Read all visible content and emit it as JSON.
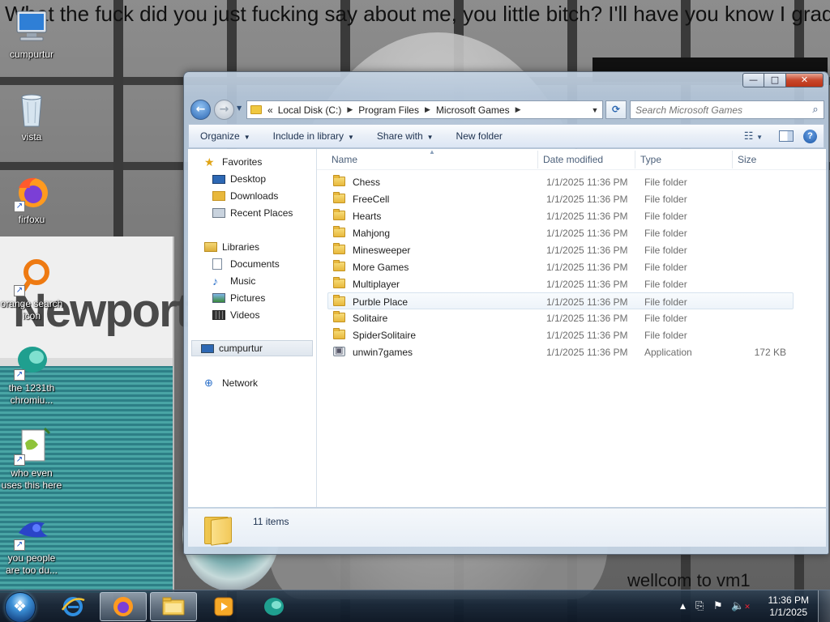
{
  "wallpaper": {
    "top_text": "What the fuck did you just fucking say about me, you little bitch? I'll have you know I graduated",
    "bottom_text": "wellcom to vm1",
    "pack_brand": "Newport"
  },
  "desktop_icons": [
    {
      "label": "cumpurtur",
      "icon": "computer-icon"
    },
    {
      "label": "vista",
      "icon": "recycle-bin-icon"
    },
    {
      "label": "firfoxu",
      "icon": "firefox-icon"
    },
    {
      "label": "orange search icon",
      "icon": "orange-search-icon"
    },
    {
      "label": "the 1231th chromiu...",
      "icon": "chromium-icon"
    },
    {
      "label": "who even uses this here",
      "icon": "notepad-icon"
    },
    {
      "label": "you people are too du...",
      "icon": "blue-app-icon"
    }
  ],
  "explorer": {
    "caption": {
      "minimize": "—",
      "maximize": "□",
      "close": "✕"
    },
    "breadcrumb": [
      "«",
      "Local Disk (C:)",
      "Program Files",
      "Microsoft Games"
    ],
    "search_placeholder": "Search Microsoft Games",
    "command_bar": {
      "organize": "Organize",
      "include_in_library": "Include in library",
      "share_with": "Share with",
      "new_folder": "New folder"
    },
    "nav_pane": {
      "favorites": "Favorites",
      "desktop": "Desktop",
      "downloads": "Downloads",
      "recent_places": "Recent Places",
      "libraries": "Libraries",
      "documents": "Documents",
      "music": "Music",
      "pictures": "Pictures",
      "videos": "Videos",
      "computer": "cumpurtur",
      "network": "Network"
    },
    "columns": {
      "name": "Name",
      "date_modified": "Date modified",
      "type": "Type",
      "size": "Size"
    },
    "files": [
      {
        "name": "Chess",
        "date": "1/1/2025 11:36 PM",
        "type": "File folder",
        "size": ""
      },
      {
        "name": "FreeCell",
        "date": "1/1/2025 11:36 PM",
        "type": "File folder",
        "size": ""
      },
      {
        "name": "Hearts",
        "date": "1/1/2025 11:36 PM",
        "type": "File folder",
        "size": ""
      },
      {
        "name": "Mahjong",
        "date": "1/1/2025 11:36 PM",
        "type": "File folder",
        "size": ""
      },
      {
        "name": "Minesweeper",
        "date": "1/1/2025 11:36 PM",
        "type": "File folder",
        "size": ""
      },
      {
        "name": "More Games",
        "date": "1/1/2025 11:36 PM",
        "type": "File folder",
        "size": ""
      },
      {
        "name": "Multiplayer",
        "date": "1/1/2025 11:36 PM",
        "type": "File folder",
        "size": ""
      },
      {
        "name": "Purble Place",
        "date": "1/1/2025 11:36 PM",
        "type": "File folder",
        "size": ""
      },
      {
        "name": "Solitaire",
        "date": "1/1/2025 11:36 PM",
        "type": "File folder",
        "size": ""
      },
      {
        "name": "SpiderSolitaire",
        "date": "1/1/2025 11:36 PM",
        "type": "File folder",
        "size": ""
      },
      {
        "name": "unwin7games",
        "date": "1/1/2025 11:36 PM",
        "type": "Application",
        "size": "172 KB"
      }
    ],
    "hovered_row": "Purble Place",
    "item_count": "11 items"
  },
  "taskbar": {
    "pinned": [
      "internet-explorer-icon",
      "firefox-icon",
      "explorer-icon",
      "media-player-icon",
      "chromium-icon"
    ],
    "active": "explorer-icon",
    "clock_time": "11:36 PM",
    "clock_date": "1/1/2025"
  },
  "colors": {
    "explorer_frame": "#b4c6da",
    "command_bar": "#e9eff7",
    "hover_row": "#eef4fa",
    "close_button": "#c8472c",
    "taskbar": "#14233a"
  }
}
